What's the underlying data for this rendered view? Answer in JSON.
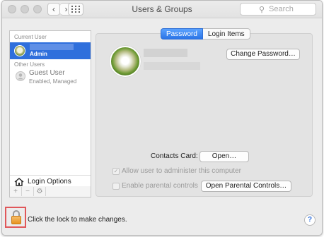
{
  "window": {
    "title": "Users & Groups"
  },
  "toolbar": {
    "back_glyph": "‹",
    "forward_glyph": "›",
    "grid_icon": "grid-icon",
    "search_placeholder": "Search"
  },
  "sidebar": {
    "current_user_heading": "Current User",
    "current_user_role": "Admin",
    "other_users_heading": "Other Users",
    "guest_name": "Guest User",
    "guest_status": "Enabled, Managed",
    "login_options_label": "Login Options",
    "tools": {
      "add": "+",
      "remove": "−",
      "action": "⚙"
    }
  },
  "tabs": [
    {
      "label": "Password",
      "active": true
    },
    {
      "label": "Login Items",
      "active": false
    }
  ],
  "panel": {
    "change_password_button": "Change Password…",
    "contacts_card_label": "Contacts Card:",
    "open_button": "Open…",
    "allow_admin_label": "Allow user to administer this computer",
    "allow_admin_checked": true,
    "parental_label": "Enable parental controls",
    "parental_checked": false,
    "open_parental_button": "Open Parental Controls…"
  },
  "footer": {
    "lock_text": "Click the lock to make changes.",
    "help_label": "?"
  },
  "colors": {
    "selection": "#2f6fdc",
    "lock_highlight": "#e0575a",
    "tab_active": "#2b74e6"
  }
}
